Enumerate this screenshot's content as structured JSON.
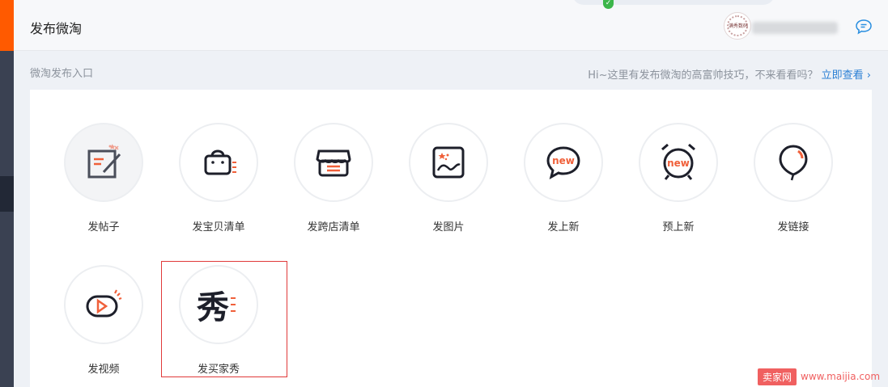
{
  "header": {
    "title": "发布微淘"
  },
  "content": {
    "entry_label": "微淘发布入口",
    "tip_text": "Hi~这里有发布微淘的高富帅技巧，不来看看吗？",
    "tip_link": "立即查看"
  },
  "avatar": {
    "text": "满秀数码"
  },
  "tiles": [
    {
      "label": "发帖子",
      "icon": "edit-post-icon"
    },
    {
      "label": "发宝贝清单",
      "icon": "shopping-bag-list-icon"
    },
    {
      "label": "发跨店清单",
      "icon": "store-list-icon"
    },
    {
      "label": "发图片",
      "icon": "image-icon"
    },
    {
      "label": "发上新",
      "icon": "new-chat-bubble-icon"
    },
    {
      "label": "预上新",
      "icon": "alarm-clock-new-icon"
    },
    {
      "label": "发链接",
      "icon": "balloon-link-icon"
    },
    {
      "label": "发视频",
      "icon": "video-play-icon"
    },
    {
      "label": "发买家秀",
      "icon": "buyer-show-icon",
      "glyph": "秀"
    }
  ],
  "watermark": {
    "badge": "卖家网",
    "url": "www.maijia.com"
  },
  "colors": {
    "accent": "#ff5a00",
    "icon_orange": "#f0603a",
    "link": "#2a7fd4",
    "highlight": "#e03a3a"
  }
}
